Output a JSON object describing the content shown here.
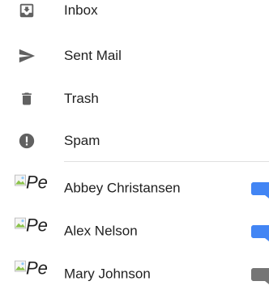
{
  "nav": {
    "items": [
      {
        "label": "Inbox",
        "icon": "inbox-icon"
      },
      {
        "label": "Sent Mail",
        "icon": "send-icon"
      },
      {
        "label": "Trash",
        "icon": "trash-icon"
      },
      {
        "label": "Spam",
        "icon": "spam-icon"
      }
    ]
  },
  "contacts": [
    {
      "name": "Abbey Christansen",
      "avatar_alt": "Pe",
      "chat_status": "active",
      "chat_color": "#4285f4"
    },
    {
      "name": "Alex Nelson",
      "avatar_alt": "Pe",
      "chat_status": "active",
      "chat_color": "#4285f4"
    },
    {
      "name": "Mary Johnson",
      "avatar_alt": "Pe",
      "chat_status": "inactive",
      "chat_color": "#757575"
    }
  ],
  "colors": {
    "icon": "#616161",
    "text": "#212121",
    "divider": "#e0e0e0"
  }
}
